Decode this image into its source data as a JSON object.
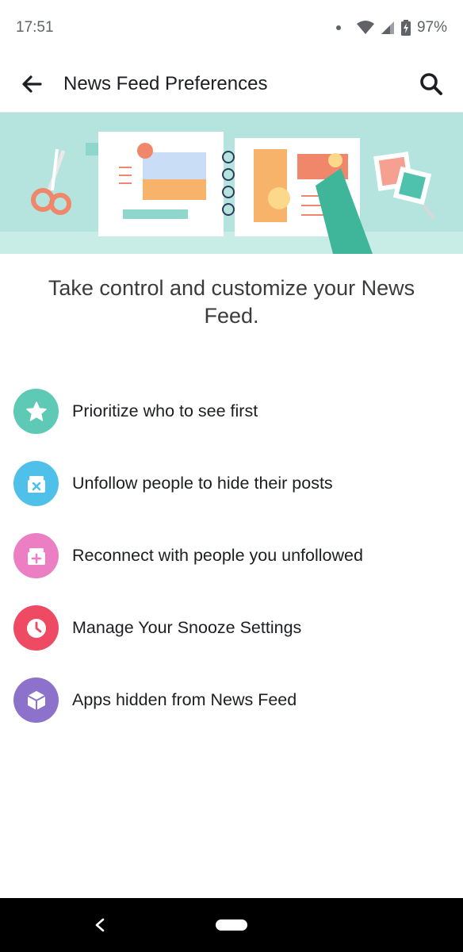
{
  "status_bar": {
    "time": "17:51",
    "battery": "97%"
  },
  "app_bar": {
    "title": "News Feed Preferences",
    "back_icon": "arrow-left-icon",
    "search_icon": "search-icon"
  },
  "hero": {
    "illustration": "scrapbook-illustration",
    "background_color": "#b4e4dd"
  },
  "tagline": "Take control and customize your News Feed.",
  "options": [
    {
      "label": "Prioritize who to see first",
      "icon": "star-icon",
      "color": "#5ec9b4"
    },
    {
      "label": "Unfollow people to hide their posts",
      "icon": "inbox-x-icon",
      "color": "#4fc0ea"
    },
    {
      "label": "Reconnect with people you unfollowed",
      "icon": "inbox-plus-icon",
      "color": "#ec7ec4"
    },
    {
      "label": "Manage Your Snooze Settings",
      "icon": "clock-icon",
      "color": "#ee4a63"
    },
    {
      "label": "Apps hidden from News Feed",
      "icon": "cube-icon",
      "color": "#8c72cb"
    }
  ],
  "nav_bar": {
    "back_icon": "nav-back-icon",
    "home_icon": "nav-home-pill"
  }
}
